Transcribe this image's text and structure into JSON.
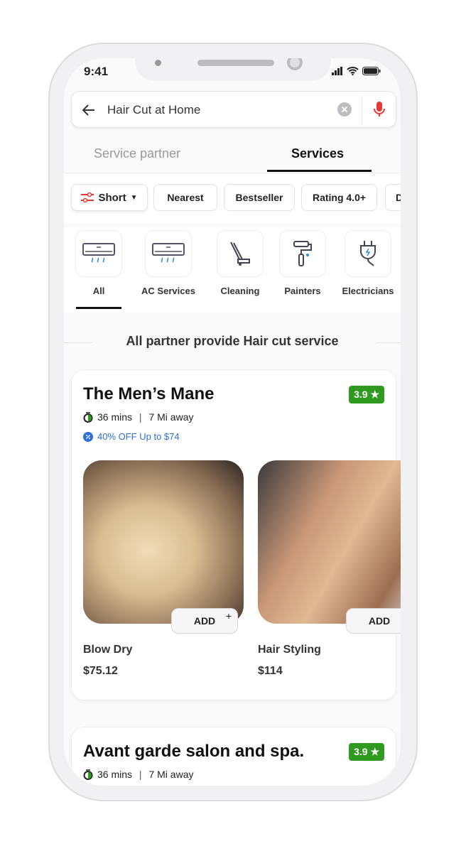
{
  "status_bar": {
    "time": "9:41"
  },
  "search": {
    "query": "Hair Cut at Home"
  },
  "tabs": [
    {
      "label": "Service partner",
      "active": false
    },
    {
      "label": "Services",
      "active": true
    }
  ],
  "filters": [
    {
      "label": "Short",
      "icon": "sliders-icon"
    },
    {
      "label": "Nearest"
    },
    {
      "label": "Bestseller"
    },
    {
      "label": "Rating 4.0+"
    },
    {
      "label": "D"
    }
  ],
  "categories": [
    {
      "label": "All",
      "icon": "ac-icon",
      "active": true
    },
    {
      "label": "AC Services",
      "icon": "ac-icon"
    },
    {
      "label": "Cleaning",
      "icon": "vacuum-icon"
    },
    {
      "label": "Painters",
      "icon": "paint-roller-icon"
    },
    {
      "label": "Electricians",
      "icon": "plug-icon"
    }
  ],
  "section_heading": "All partner provide Hair cut service",
  "colors": {
    "accent": "#2f9a1f",
    "offer": "#2f6fd8",
    "mic": "#e53935"
  },
  "partners": [
    {
      "name": "The Men’s Mane",
      "rating": "3.9 ★",
      "time": "36 mins",
      "distance": "7 Mi away",
      "offer": "40% OFF Up to $74",
      "services": [
        {
          "name": "Blow Dry",
          "price": "$75.12",
          "add": "ADD",
          "add_icon": "+"
        },
        {
          "name": "Hair Styling",
          "price": "$114",
          "add": "ADD"
        }
      ]
    },
    {
      "name": "Avant garde salon and spa.",
      "rating": "3.9 ★",
      "time": "36 mins",
      "distance": "7 Mi away"
    }
  ]
}
